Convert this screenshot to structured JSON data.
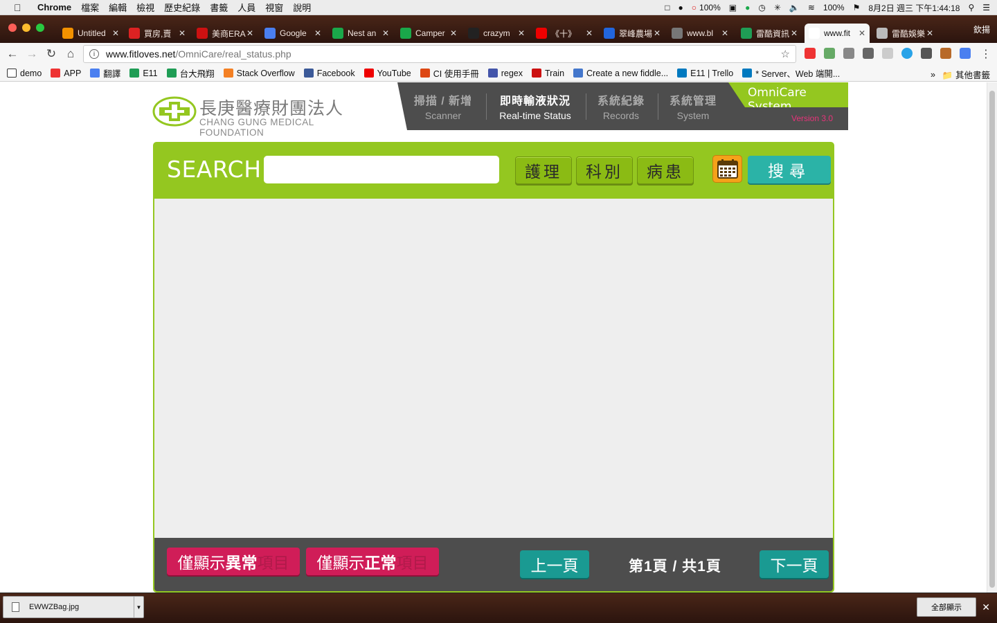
{
  "os_menubar": {
    "app": "Chrome",
    "menus": [
      "檔案",
      "編輯",
      "檢視",
      "歷史紀錄",
      "書籤",
      "人員",
      "視窗",
      "說明"
    ],
    "zoom": "100%",
    "battery": "100%",
    "datetime": "8月2日 週三 下午1:44:18"
  },
  "browser": {
    "tabs": [
      {
        "title": "Untitled",
        "color": "#f29100"
      },
      {
        "title": "買房,賣",
        "color": "#d22"
      },
      {
        "title": "美商ERA",
        "color": "#c11"
      },
      {
        "title": "Google",
        "color": "#4a7ff0"
      },
      {
        "title": "Nest an",
        "color": "#1aa84a"
      },
      {
        "title": "Camper",
        "color": "#1aa84a"
      },
      {
        "title": "crazym",
        "color": "#222"
      },
      {
        "title": "《十》",
        "color": "#e00"
      },
      {
        "title": "翠峰農場",
        "color": "#2266dd"
      },
      {
        "title": "www.bl",
        "color": "#777"
      },
      {
        "title": "雷酷資訊",
        "color": "#1f9d55"
      },
      {
        "title": "www.fit",
        "color": "#ffffff",
        "active": true
      },
      {
        "title": "雷酷娛樂",
        "color": "#bbbbbb"
      }
    ],
    "profile": "欽揚",
    "url_host": "www.fitloves.net",
    "url_path": "/OmniCare/real_status.php",
    "bookmarks": [
      {
        "label": "demo",
        "color": "#ffffff"
      },
      {
        "label": "APP",
        "color": "#e33"
      },
      {
        "label": "翻譯",
        "color": "#4a7ff0"
      },
      {
        "label": "E11",
        "color": "#1f9d55"
      },
      {
        "label": "台大飛翔",
        "color": "#1f9d55"
      },
      {
        "label": "Stack Overflow",
        "color": "#f48024"
      },
      {
        "label": "Facebook",
        "color": "#3b5998"
      },
      {
        "label": "YouTube",
        "color": "#e00"
      },
      {
        "label": "CI 使用手冊",
        "color": "#dd4814"
      },
      {
        "label": "regex",
        "color": "#4455aa"
      },
      {
        "label": "Train",
        "color": "#cc1111"
      },
      {
        "label": "Create a new fiddle...",
        "color": "#4477cc"
      },
      {
        "label": "E11 | Trello",
        "color": "#0079bf"
      },
      {
        "label": "* Server、Web 端開...",
        "color": "#0079bf"
      }
    ],
    "bookmarks_more": "»",
    "other_bookmarks": "其他書籤"
  },
  "site": {
    "logo_cn": "長庚醫療財團法人",
    "logo_en": "CHANG GUNG MEDICAL FOUNDATION",
    "brand": "OmniCare System",
    "version": "Version 3.0",
    "nav": [
      {
        "zh": "掃描 / 新增",
        "en": "Scanner"
      },
      {
        "zh": "即時輸液狀況",
        "en": "Real-time Status",
        "active": true
      },
      {
        "zh": "系統紀錄",
        "en": "Records"
      },
      {
        "zh": "系統管理",
        "en": "System"
      }
    ],
    "search": {
      "label": "SEARCH",
      "value": "",
      "filters": [
        "護理",
        "科別",
        "病患"
      ],
      "submit": "搜尋"
    },
    "footer": {
      "abnormal_prefix": "僅顯示",
      "abnormal_key": "異常",
      "abnormal_suffix": "項目",
      "normal_prefix": "僅顯示",
      "normal_key": "正常",
      "normal_suffix": "項目",
      "prev": "上一頁",
      "page_info": "第1頁 / 共1頁",
      "next": "下一頁"
    }
  },
  "download_bar": {
    "file": "EWWZBag.jpg",
    "show_all": "全部顯示"
  },
  "colors": {
    "green": "#94c720",
    "teal": "#1a9a92",
    "pink": "#d01d58",
    "dark": "#4d4d4d"
  }
}
